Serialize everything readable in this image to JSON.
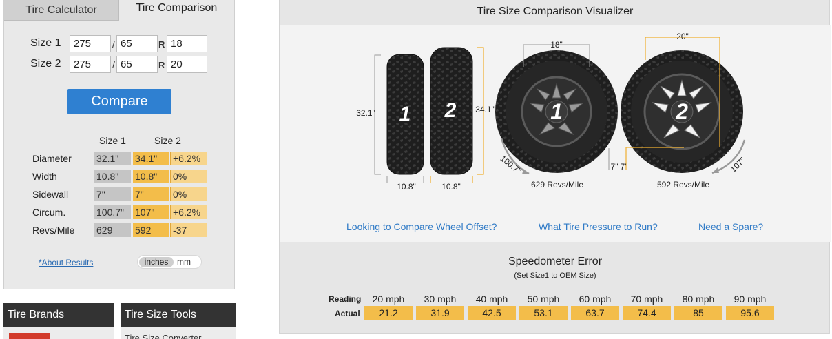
{
  "tabs": {
    "calculator": "Tire Calculator",
    "comparison": "Tire Comparison"
  },
  "size1": {
    "label": "Size 1",
    "width": "275",
    "aspect": "65",
    "rim": "18"
  },
  "size2": {
    "label": "Size 2",
    "width": "275",
    "aspect": "65",
    "rim": "20"
  },
  "separators": {
    "slash": "/",
    "r": "R"
  },
  "compare_button": "Compare",
  "results": {
    "headers": [
      "Size 1",
      "Size 2"
    ],
    "rows": [
      {
        "label": "Diameter",
        "s1": "32.1\"",
        "s2": "34.1\"",
        "diff": "+6.2%"
      },
      {
        "label": "Width",
        "s1": "10.8\"",
        "s2": "10.8\"",
        "diff": "0%"
      },
      {
        "label": "Sidewall",
        "s1": "7\"",
        "s2": "7\"",
        "diff": "0%"
      },
      {
        "label": "Circum.",
        "s1": "100.7\"",
        "s2": "107\"",
        "diff": "+6.2%"
      },
      {
        "label": "Revs/Mile",
        "s1": "629",
        "s2": "592",
        "diff": "-37"
      }
    ]
  },
  "about_link": "*About Results",
  "units": {
    "selected": "inches",
    "other": "mm"
  },
  "bottom_boxes": {
    "brands": "Tire Brands",
    "tools": "Tire Size Tools",
    "tools_first_link": "Tire Size Converter"
  },
  "visualizer": {
    "title": "Tire Size Comparison Visualizer",
    "side_view": {
      "height1": "32.1\"",
      "height2": "34.1\"",
      "width1": "10.8\"",
      "width2": "10.8\"",
      "num1": "1",
      "num2": "2"
    },
    "wheel1": {
      "rim": "18\"",
      "sidewall": "7\"",
      "circum": "100.7\"",
      "revs": "629 Revs/Mile",
      "num": "1"
    },
    "wheel2": {
      "rim": "20\"",
      "sidewall": "7\"",
      "circum": "107\"",
      "revs": "592 Revs/Mile",
      "num": "2"
    },
    "links": [
      "Looking to Compare Wheel Offset?",
      "What Tire Pressure to Run?",
      "Need a Spare?"
    ]
  },
  "speedometer": {
    "title": "Speedometer Error",
    "subtitle": "(Set Size1 to OEM Size)",
    "reading_label": "Reading",
    "actual_label": "Actual",
    "readings": [
      "20 mph",
      "30 mph",
      "40 mph",
      "50 mph",
      "60 mph",
      "70 mph",
      "80 mph",
      "90 mph"
    ],
    "actual": [
      "21.2",
      "31.9",
      "42.5",
      "53.1",
      "63.7",
      "74.4",
      "85",
      "95.6"
    ]
  },
  "colors": {
    "accent_gold": "#f3bd4a",
    "button_blue": "#2f80d1",
    "link_blue": "#2f7ac6",
    "dim_line": "#f0b030"
  }
}
